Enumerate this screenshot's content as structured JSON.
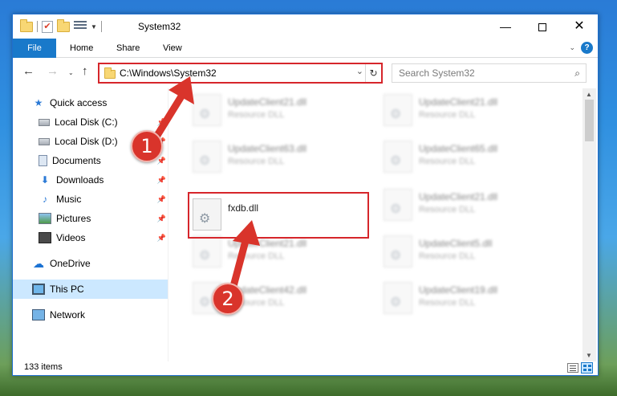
{
  "window": {
    "title": "System32",
    "minimize": "—",
    "close": "✕"
  },
  "ribbon": {
    "tabs": [
      "File",
      "Home",
      "Share",
      "View"
    ],
    "collapse": "⌄",
    "help": "?"
  },
  "nav": {
    "back": "←",
    "forward": "→",
    "recent": "⌄",
    "up": "↑",
    "address": "C:\\Windows\\System32",
    "address_dropdown": "⌄",
    "refresh": "↻",
    "search_placeholder": "Search System32",
    "search_icon": "⌕"
  },
  "sidebar": {
    "items": [
      {
        "label": "Quick access",
        "icon": "star-icon",
        "pinned": false
      },
      {
        "label": "Local Disk (C:)",
        "icon": "disk-icon",
        "pinned": true
      },
      {
        "label": "Local Disk (D:)",
        "icon": "disk-icon",
        "pinned": true
      },
      {
        "label": "Documents",
        "icon": "documents-icon",
        "pinned": true
      },
      {
        "label": "Downloads",
        "icon": "downloads-icon",
        "pinned": true
      },
      {
        "label": "Music",
        "icon": "music-icon",
        "pinned": true
      },
      {
        "label": "Pictures",
        "icon": "pictures-icon",
        "pinned": true
      },
      {
        "label": "Videos",
        "icon": "videos-icon",
        "pinned": true
      },
      {
        "label": "OneDrive",
        "icon": "onedrive-icon",
        "pinned": false
      },
      {
        "label": "This PC",
        "icon": "this-pc-icon",
        "pinned": false,
        "selected": true
      },
      {
        "label": "Network",
        "icon": "network-icon",
        "pinned": false
      }
    ]
  },
  "files": [
    {
      "name": "UpdateClient21.dll",
      "type": "Resource DLL",
      "blurred": true
    },
    {
      "name": "UpdateClient21.dll",
      "type": "Resource DLL",
      "blurred": true
    },
    {
      "name": "UpdateClient63.dll",
      "type": "Resource DLL",
      "blurred": true
    },
    {
      "name": "UpdateClient65.dll",
      "type": "Resource DLL",
      "blurred": true
    },
    {
      "name": "fxdb.dll",
      "type": "",
      "blurred": false,
      "highlighted": true
    },
    {
      "name": "UpdateClient21.dll",
      "type": "Resource DLL",
      "blurred": true
    },
    {
      "name": "UpdateClient21.dll",
      "type": "Resource DLL",
      "blurred": true
    },
    {
      "name": "UpdateClient5.dll",
      "type": "Resource DLL",
      "blurred": true
    },
    {
      "name": "UpdateClient42.dll",
      "type": "Resource DLL",
      "blurred": true
    },
    {
      "name": "UpdateClient19.dll",
      "type": "Resource DLL",
      "blurred": true
    }
  ],
  "status": {
    "item_count": "133 items"
  },
  "annotations": {
    "step1": "1",
    "step2": "2",
    "highlight_color": "#d6262b"
  },
  "colors": {
    "accent": "#1979ca",
    "selection": "#cce8ff",
    "annotation": "#d9342b"
  }
}
